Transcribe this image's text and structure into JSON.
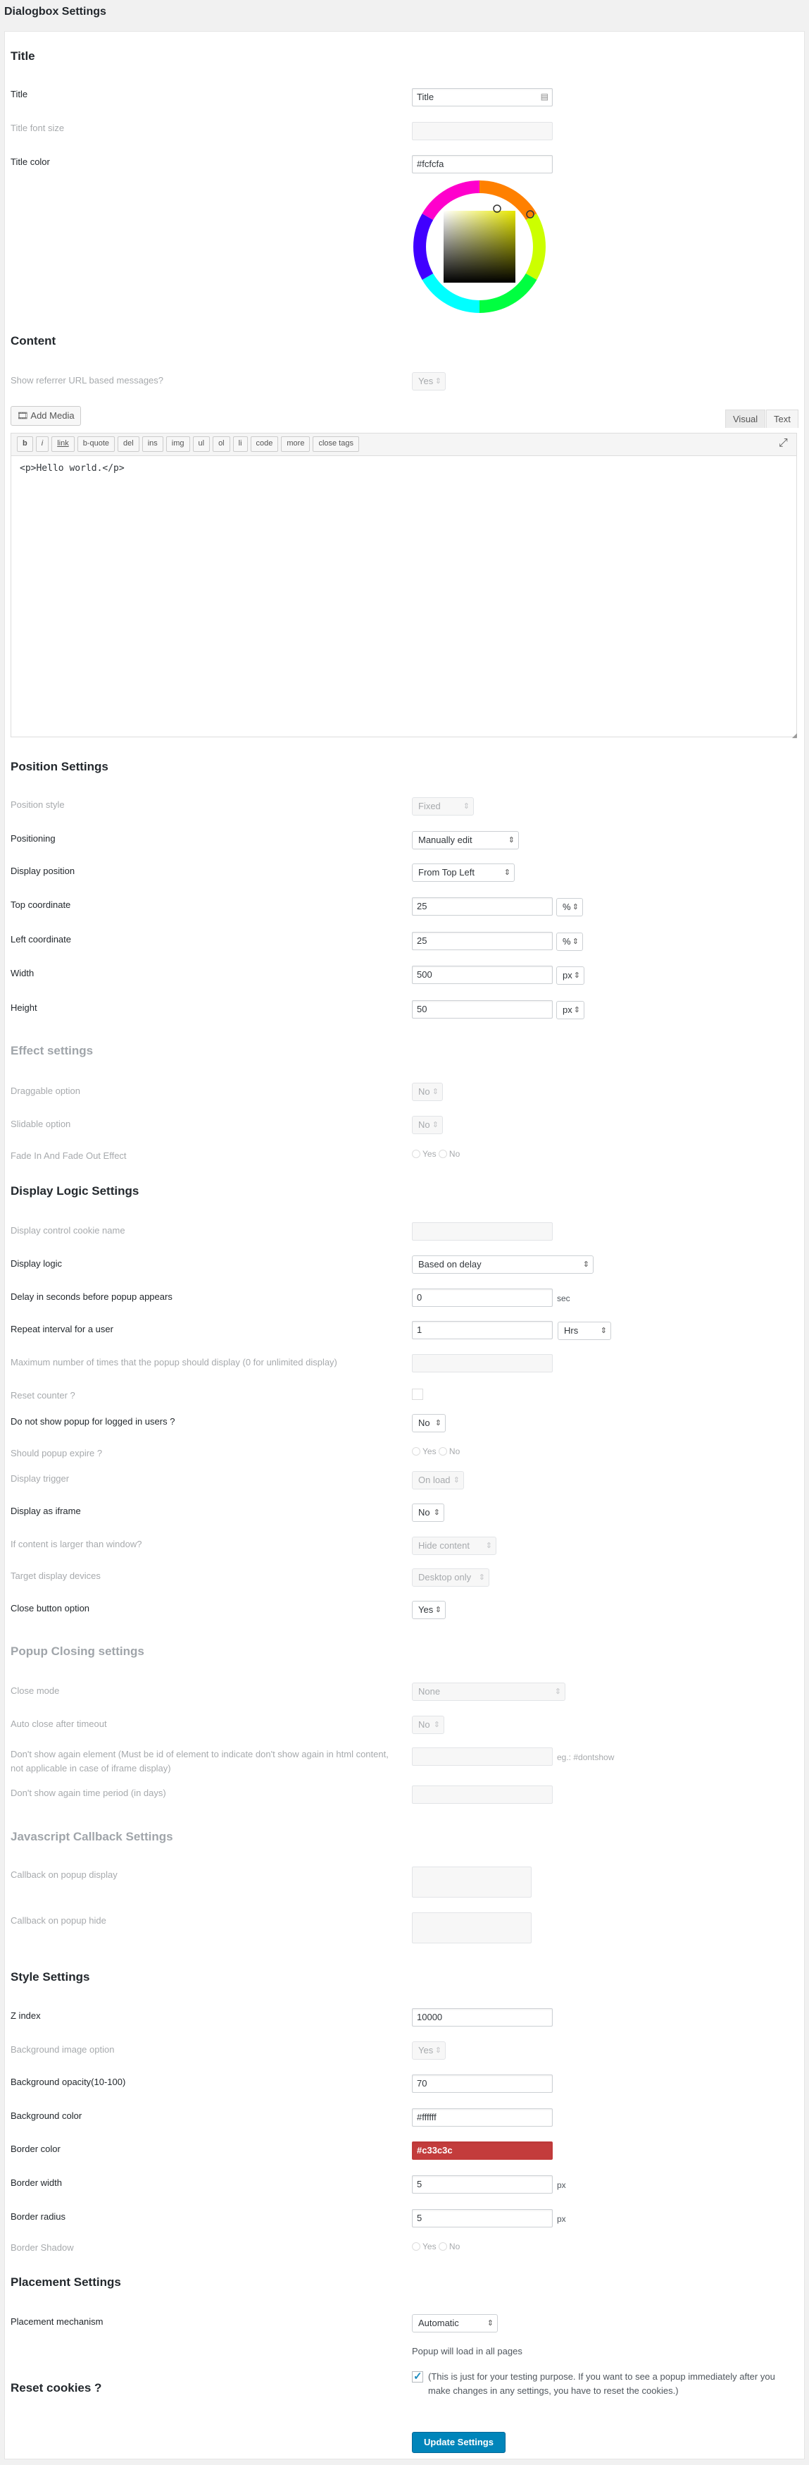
{
  "page_title": "Dialogbox Settings",
  "sections": {
    "title": "Title",
    "content": "Content",
    "position": "Position Settings",
    "effect": "Effect settings",
    "logic": "Display Logic Settings",
    "closing": "Popup Closing settings",
    "js": "Javascript Callback Settings",
    "style": "Style Settings",
    "placement": "Placement Settings",
    "reset": "Reset cookies ?"
  },
  "title_section": {
    "title_label": "Title",
    "title_value": "Title",
    "font_size_label": "Title font size",
    "color_label": "Title color",
    "color_value": "#fcfcfa"
  },
  "content_section": {
    "referrer_label": "Show referrer URL based messages?",
    "referrer_value": "Yes",
    "add_media": "Add Media",
    "tab_visual": "Visual",
    "tab_text": "Text",
    "qt_buttons": [
      "b",
      "i",
      "link",
      "b-quote",
      "del",
      "ins",
      "img",
      "ul",
      "ol",
      "li",
      "code",
      "more",
      "close tags"
    ],
    "editor_text": "<p>Hello world.</p>"
  },
  "position_section": {
    "style_label": "Position style",
    "style_value": "Fixed",
    "positioning_label": "Positioning",
    "positioning_value": "Manually edit",
    "display_position_label": "Display position",
    "display_position_value": "From Top Left",
    "top_label": "Top coordinate",
    "top_value": "25",
    "top_unit": "%",
    "left_label": "Left coordinate",
    "left_value": "25",
    "left_unit": "%",
    "width_label": "Width",
    "width_value": "500",
    "width_unit": "px",
    "height_label": "Height",
    "height_value": "50",
    "height_unit": "px"
  },
  "effect_section": {
    "draggable_label": "Draggable option",
    "draggable_value": "No",
    "slidable_label": "Slidable option",
    "slidable_value": "No",
    "fade_label": "Fade In And Fade Out Effect",
    "yes": "Yes",
    "no": "No"
  },
  "logic_section": {
    "cookie_label": "Display control cookie name",
    "logic_label": "Display logic",
    "logic_value": "Based on delay",
    "delay_label": "Delay in seconds before popup appears",
    "delay_value": "0",
    "delay_unit": "sec",
    "repeat_label": "Repeat interval for a user",
    "repeat_value": "1",
    "repeat_unit": "Hrs",
    "max_label": "Maximum number of times that the popup should display (0 for unlimited display)",
    "reset_counter_label": "Reset counter ?",
    "logged_label": "Do not show popup for logged in users ?",
    "logged_value": "No",
    "expire_label": "Should popup expire ?",
    "trigger_label": "Display trigger",
    "trigger_value": "On load",
    "iframe_label": "Display as iframe",
    "iframe_value": "No",
    "larger_label": "If content is larger than window?",
    "larger_value": "Hide content",
    "devices_label": "Target display devices",
    "devices_value": "Desktop only",
    "close_btn_label": "Close button option",
    "close_btn_value": "Yes"
  },
  "closing_section": {
    "close_mode_label": "Close mode",
    "close_mode_value": "None",
    "auto_close_label": "Auto close after timeout",
    "auto_close_value": "No",
    "dont_show_el_label": "Don't show again element (Must be id of element to indicate don't show again in html content, not applicable in case of iframe display)",
    "dont_show_el_hint": "eg.: #dontshow",
    "dont_show_period_label": "Don't show again time period (in days)"
  },
  "js_section": {
    "display_cb_label": "Callback on popup display",
    "hide_cb_label": "Callback on popup hide"
  },
  "style_section": {
    "z_label": "Z index",
    "z_value": "10000",
    "bg_image_label": "Background image option",
    "bg_image_value": "Yes",
    "opacity_label": "Background opacity(10-100)",
    "opacity_value": "70",
    "bg_color_label": "Background color",
    "bg_color_value": "#ffffff",
    "border_color_label": "Border color",
    "border_color_value": "#c33c3c",
    "border_width_label": "Border width",
    "border_width_value": "5",
    "border_width_unit": "px",
    "border_radius_label": "Border radius",
    "border_radius_value": "5",
    "border_radius_unit": "px",
    "shadow_label": "Border Shadow"
  },
  "placement_section": {
    "mechanism_label": "Placement mechanism",
    "mechanism_value": "Automatic",
    "note": "Popup will load in all pages",
    "reset_note": "(This is just for your testing purpose. If you want to see a popup immediately after you make changes in any settings, you have to reset the cookies.)",
    "submit": "Update Settings"
  },
  "colors": {
    "accent": "#0085ba",
    "border_color_swatch": "#c33c3c"
  }
}
